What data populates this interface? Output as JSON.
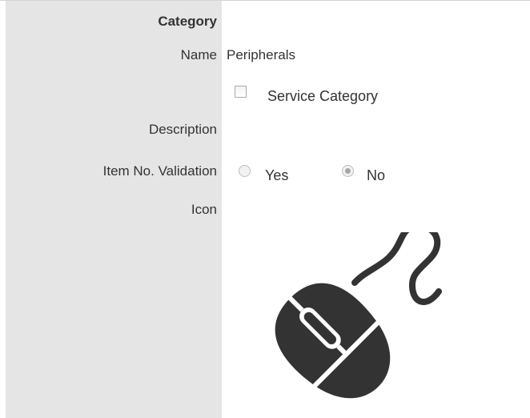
{
  "form": {
    "section_header": "Category",
    "fields": {
      "name": {
        "label": "Name",
        "value": "Peripherals"
      },
      "service_category": {
        "label": "Service Category",
        "checked": false
      },
      "description": {
        "label": "Description",
        "value": ""
      },
      "item_no_validation": {
        "label": "Item No. Validation",
        "options": [
          "Yes",
          "No"
        ],
        "selected": "No"
      },
      "icon": {
        "label": "Icon",
        "icon_name": "computer-mouse-icon",
        "color": "#333333"
      }
    }
  },
  "colors": {
    "label_column_bg": "#e5e5e5",
    "text": "#333333",
    "radio_selected": "#a6a6a6"
  }
}
